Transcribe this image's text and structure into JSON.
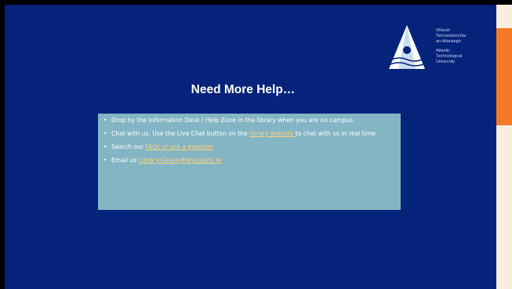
{
  "slide": {
    "title": "Need More Help…",
    "logo": {
      "lines_irish": [
        "Ollscoil",
        "Teicneolaíochta",
        "an Atlantaigh"
      ],
      "lines_english": [
        "Atlantic",
        "Technological",
        "University"
      ]
    },
    "bullets": [
      {
        "text": "Drop by the Information Desk / Help Zone in the library when you are on campus."
      },
      {
        "pre": "Chat with us. Use the Live Chat button on the ",
        "link": "library website ",
        "post": "to chat with us in real time."
      },
      {
        "pre": "Search our ",
        "link": "FAQs or ask a question",
        "post": ""
      },
      {
        "pre": "Email us ",
        "link": "Library.GalwayMayo@atu.ie",
        "post": ""
      }
    ],
    "bullet_char": "•"
  },
  "colors": {
    "slide_bg": "#05237a",
    "panel_bg": "#84b5c4",
    "link": "#ffd27a",
    "accent_orange": "#f47a2a",
    "accent_cream": "#fbece0"
  }
}
